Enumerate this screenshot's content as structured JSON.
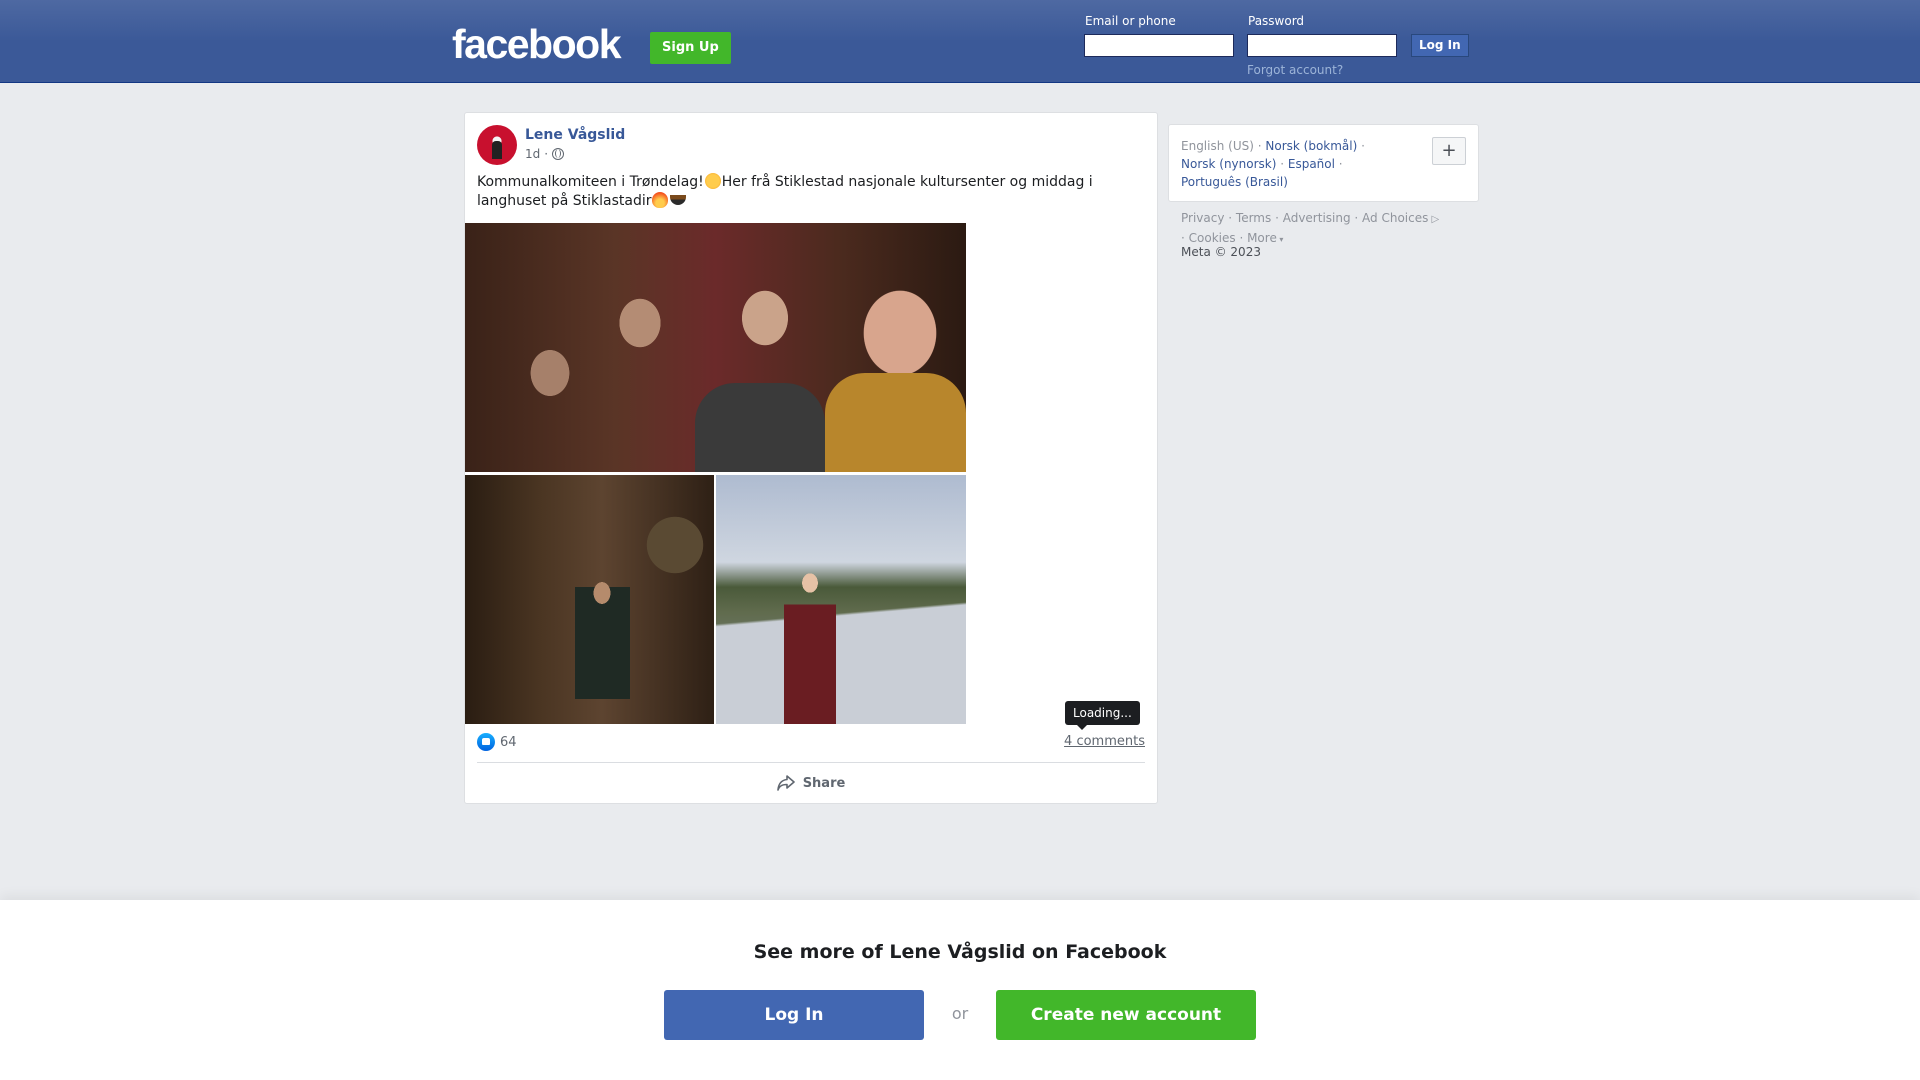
{
  "header": {
    "logo": "facebook",
    "signup_label": "Sign Up",
    "email_label": "Email or phone",
    "email_value": "",
    "password_label": "Password",
    "password_value": "",
    "login_label": "Log In",
    "forgot_label": "Forgot account?"
  },
  "post": {
    "author": "Lene Vågslid",
    "time": "1d",
    "separator": "·",
    "privacy_icon": "globe-icon",
    "text_part1": "Kommunalkomiteen i Trøndelag!",
    "text_part2": "Her frå Stiklestad nasjonale kultursenter og middag i langhuset på Stiklastadir",
    "reaction_icon": "like-icon",
    "reaction_count": "64",
    "comments": "4 comments",
    "tooltip": "Loading...",
    "share_label": "Share"
  },
  "languages": {
    "current": "English (US)",
    "items": [
      "Norsk (bokmål)",
      "Norsk (nynorsk)",
      "Español",
      "Português (Brasil)"
    ],
    "more_label": "+"
  },
  "footer": {
    "links": [
      "Privacy",
      "Terms",
      "Advertising",
      "Ad Choices",
      "Cookies",
      "More"
    ],
    "copyright": "Meta © 2023"
  },
  "banner": {
    "title": "See more of Lene Vågslid on Facebook",
    "login_label": "Log In",
    "or_label": "or",
    "create_label": "Create new account"
  },
  "colors": {
    "header_blue": "#3b5998",
    "green": "#42b72a",
    "link_blue": "#385898",
    "button_blue": "#4267b2"
  }
}
